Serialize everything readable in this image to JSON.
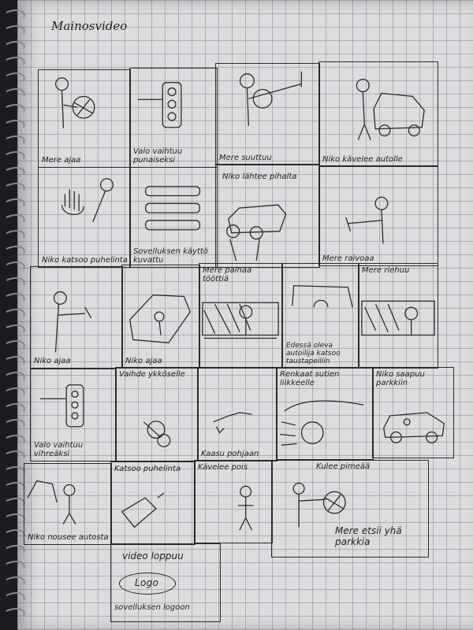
{
  "title": "Mainosvideo",
  "panels": [
    {
      "id": "p1",
      "caption": "Mere ajaa"
    },
    {
      "id": "p2",
      "caption": "Valo vaihtuu punaiseksi"
    },
    {
      "id": "p3",
      "caption": "Mere suuttuu"
    },
    {
      "id": "p4",
      "caption": "Niko kävelee autolle"
    },
    {
      "id": "p5",
      "caption": "Niko katsoo puhelinta"
    },
    {
      "id": "p6",
      "caption": "Sovelluksen käyttö kuvattu"
    },
    {
      "id": "p7",
      "caption": "Niko lähtee pihalta"
    },
    {
      "id": "p8",
      "caption": "Mere raivoaa"
    },
    {
      "id": "p9",
      "caption": "Niko ajaa"
    },
    {
      "id": "p10",
      "caption": "Niko ajaa"
    },
    {
      "id": "p11",
      "caption": "Mere painaa tööttiä"
    },
    {
      "id": "p12",
      "caption": "Edessä oleva autoilija katsoo taustapeiliin"
    },
    {
      "id": "p13",
      "caption": "Mere riehuu"
    },
    {
      "id": "p14",
      "caption": "Valo vaihtuu vihreäksi"
    },
    {
      "id": "p15",
      "caption": "Vaihde ykköselle"
    },
    {
      "id": "p16",
      "caption": "Kaasu pohjaan"
    },
    {
      "id": "p17",
      "caption": "Renkaat sutien liikkeelle"
    },
    {
      "id": "p18",
      "caption": "Niko saapuu parkkiin"
    },
    {
      "id": "p19",
      "caption": "Niko nousee autosta"
    },
    {
      "id": "p20",
      "caption": "Katsoo puhelinta"
    },
    {
      "id": "p21",
      "caption": "Kävelee pois"
    },
    {
      "id": "p22",
      "caption": "Mere etsii yhä parkkia"
    },
    {
      "id": "p22b",
      "caption": "Kulee pimeää"
    },
    {
      "id": "p23",
      "caption": "video loppuu"
    },
    {
      "id": "p23b",
      "caption": "sovelluksen logoon"
    }
  ],
  "logo_text": "Logo"
}
